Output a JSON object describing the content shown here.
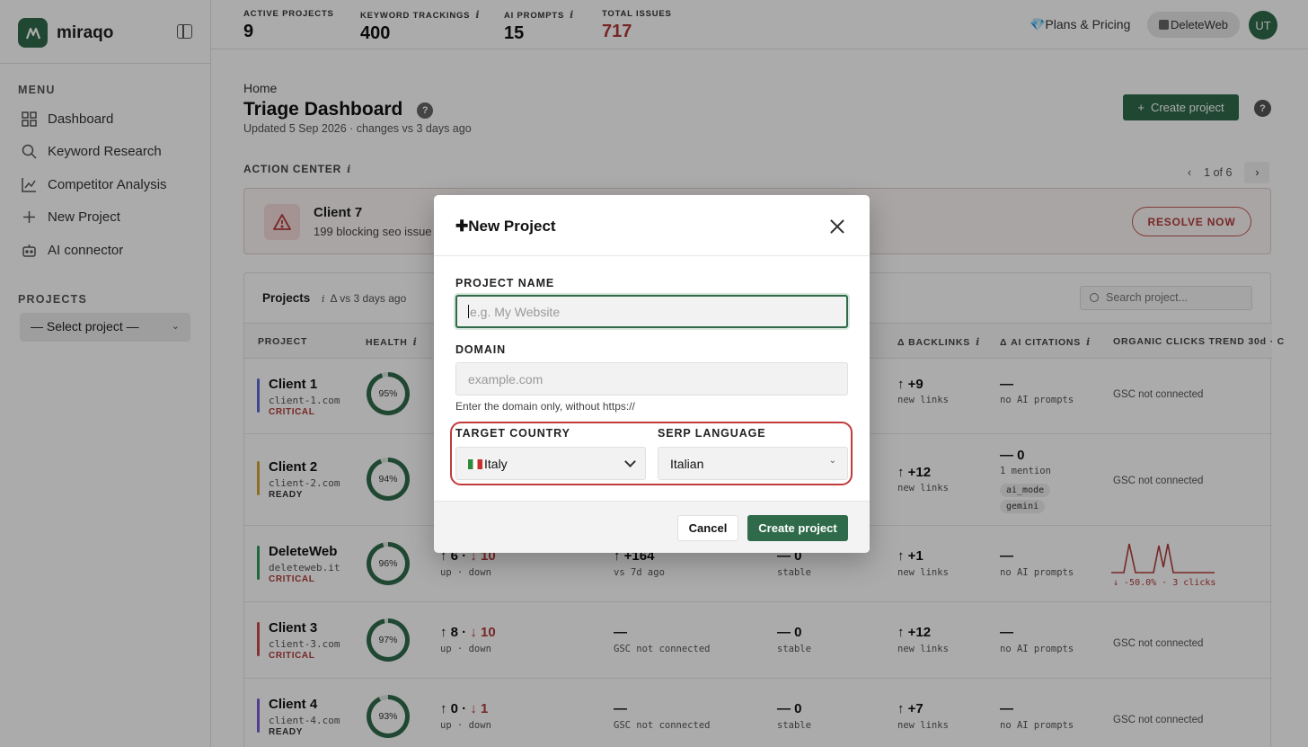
{
  "app": {
    "logo_text": "miraqo"
  },
  "sidebar": {
    "menu_label": "MENU",
    "items": [
      {
        "label": "Dashboard",
        "icon": "grid-icon"
      },
      {
        "label": "Keyword Research",
        "icon": "search-icon"
      },
      {
        "label": "Competitor Analysis",
        "icon": "chart-icon"
      },
      {
        "label": "New Project",
        "icon": "plus-icon"
      },
      {
        "label": "AI connector",
        "icon": "robot-icon"
      }
    ],
    "projects_label": "PROJECTS",
    "project_select": "— Select project —"
  },
  "topbar": {
    "stats": [
      {
        "label": "ACTIVE PROJECTS",
        "value": "9",
        "info": ""
      },
      {
        "label": "KEYWORD TRACKINGS",
        "value": "400",
        "info": "i"
      },
      {
        "label": "AI PROMPTS",
        "value": "15",
        "info": "i"
      },
      {
        "label": "TOTAL ISSUES",
        "value": "717",
        "info": ""
      }
    ],
    "plans": "💎Plans & Pricing",
    "workspace": "DeleteWeb",
    "avatar": "UT"
  },
  "header": {
    "breadcrumb": "Home",
    "title": "Triage Dashboard",
    "help": "?",
    "updated": "Updated 5 Sep 2026 · changes vs 3 days ago",
    "create_button": "Create project"
  },
  "action_center": {
    "label": "ACTION CENTER",
    "info": "i",
    "pager": "1 of 6",
    "client": "Client 7",
    "description": "199 blocking seo issue",
    "resolve": "RESOLVE NOW"
  },
  "projects": {
    "title": "Projects",
    "subtitle": "Δ vs 3 days ago",
    "search_placeholder": "Search project...",
    "columns": [
      "PROJECT",
      "HEALTH",
      "Δ BACKLINKS",
      "Δ AI CITATIONS",
      "ORGANIC CLICKS TREND 30d · C"
    ],
    "rows": [
      {
        "name": "Client 1",
        "domain": "client-1.com",
        "status": "CRITICAL",
        "health": "95%",
        "health_value": 95,
        "bar_color": "#5b6bd6",
        "kw": "",
        "kw_sub": "",
        "gsc": "",
        "gsc_sub": "",
        "pos": "",
        "pos_sub": "",
        "bl": "↑ +9",
        "bl_sub": "new links",
        "ai": "—",
        "ai_sub": "no AI prompts",
        "trend": "GSC not connected"
      },
      {
        "name": "Client 2",
        "domain": "client-2.com",
        "status": "READY",
        "health": "94%",
        "health_value": 94,
        "bar_color": "#d4a53a",
        "kw": "",
        "kw_sub": "",
        "gsc": "",
        "gsc_sub": "",
        "pos": "",
        "pos_sub": "",
        "bl": "↑ +12",
        "bl_sub": "new links",
        "ai": "— 0",
        "ai_sub": "1 mention",
        "trend": "GSC not connected",
        "chips": [
          "ai_mode",
          "gemini"
        ]
      },
      {
        "name": "DeleteWeb",
        "domain": "deleteweb.it",
        "status": "CRITICAL",
        "health": "96%",
        "health_value": 96,
        "bar_color": "#2f9a5a",
        "kw_up": "↑ 6",
        "kw_down": "↓ 10",
        "kw_sub": "up · down",
        "gsc": "↑ +164",
        "gsc_sub": "vs 7d ago",
        "pos": "— 0",
        "pos_sub": "stable",
        "bl": "↑ +1",
        "bl_sub": "new links",
        "ai": "—",
        "ai_sub": "no AI prompts",
        "trend_note": "↓ -50.0% · 3 clicks"
      },
      {
        "name": "Client 3",
        "domain": "client-3.com",
        "status": "CRITICAL",
        "health": "97%",
        "health_value": 97,
        "bar_color": "#c94b4b",
        "kw_up": "↑ 8",
        "kw_down": "↓ 10",
        "kw_sub": "up · down",
        "gsc": "—",
        "gsc_sub": "GSC not connected",
        "pos": "— 0",
        "pos_sub": "stable",
        "bl": "↑ +12",
        "bl_sub": "new links",
        "ai": "—",
        "ai_sub": "no AI prompts",
        "trend": "GSC not connected"
      },
      {
        "name": "Client 4",
        "domain": "client-4.com",
        "status": "READY",
        "health": "93%",
        "health_value": 93,
        "bar_color": "#7b5bd6",
        "kw_up": "↑ 0",
        "kw_down": "↓ 1",
        "kw_sub": "up · down",
        "gsc": "—",
        "gsc_sub": "GSC not connected",
        "pos": "— 0",
        "pos_sub": "stable",
        "bl": "↑ +7",
        "bl_sub": "new links",
        "ai": "—",
        "ai_sub": "no AI prompts",
        "trend": "GSC not connected"
      }
    ]
  },
  "modal": {
    "title": "New Project",
    "project_name_label": "PROJECT NAME",
    "project_name_placeholder": "e.g. My Website",
    "domain_label": "DOMAIN",
    "domain_placeholder": "example.com",
    "domain_hint": "Enter the domain only, without https://",
    "country_label": "TARGET COUNTRY",
    "country_value": "Italy",
    "language_label": "SERP LANGUAGE",
    "language_value": "Italian",
    "cancel": "Cancel",
    "create": "Create project"
  },
  "colors": {
    "accent": "#2f6b4a",
    "danger": "#b23b3b",
    "highlight": "#c23a3a"
  }
}
